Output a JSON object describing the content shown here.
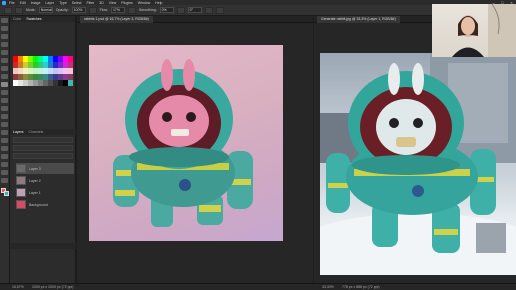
{
  "menu": {
    "items": [
      "File",
      "Edit",
      "Image",
      "Layer",
      "Type",
      "Select",
      "Filter",
      "3D",
      "View",
      "Plugins",
      "Window",
      "Help"
    ]
  },
  "options": {
    "mode_label": "Mode:",
    "mode_value": "Normal",
    "opacity_label": "Opacity:",
    "opacity_value": "100%",
    "flow_label": "Flow:",
    "flow_value": "17%",
    "smoothing_label": "Smoothing:",
    "smoothing_value": "0%",
    "angle_value": "0°"
  },
  "panels": {
    "tabs": [
      "Color",
      "Swatches"
    ],
    "layers_tabs": [
      "Layers",
      "Channels"
    ],
    "layers": [
      {
        "name": "Layer 3"
      },
      {
        "name": "Layer 2"
      },
      {
        "name": "Layer 1"
      },
      {
        "name": "Background"
      }
    ]
  },
  "doc_left": {
    "tab": "rabbits 1.psd @ 16,7% (Layer 3, RGB/8#)"
  },
  "doc_right": {
    "tab": "Generate rabbit.jpg @ 33,3% (Layer 1, RGB/8#)"
  },
  "status": {
    "left_zoom": "16,67%",
    "left_size": "2000 px x 2000 px (72 ppi)",
    "right_zoom": "33,33%",
    "right_size": "778 px x 888 px (72 ppi)"
  },
  "colors": {
    "photoshop_blue": "#31a8ff",
    "foreground": "#e85870",
    "background": "#3fb8b0",
    "suit_teal": "#3fb8b0"
  }
}
